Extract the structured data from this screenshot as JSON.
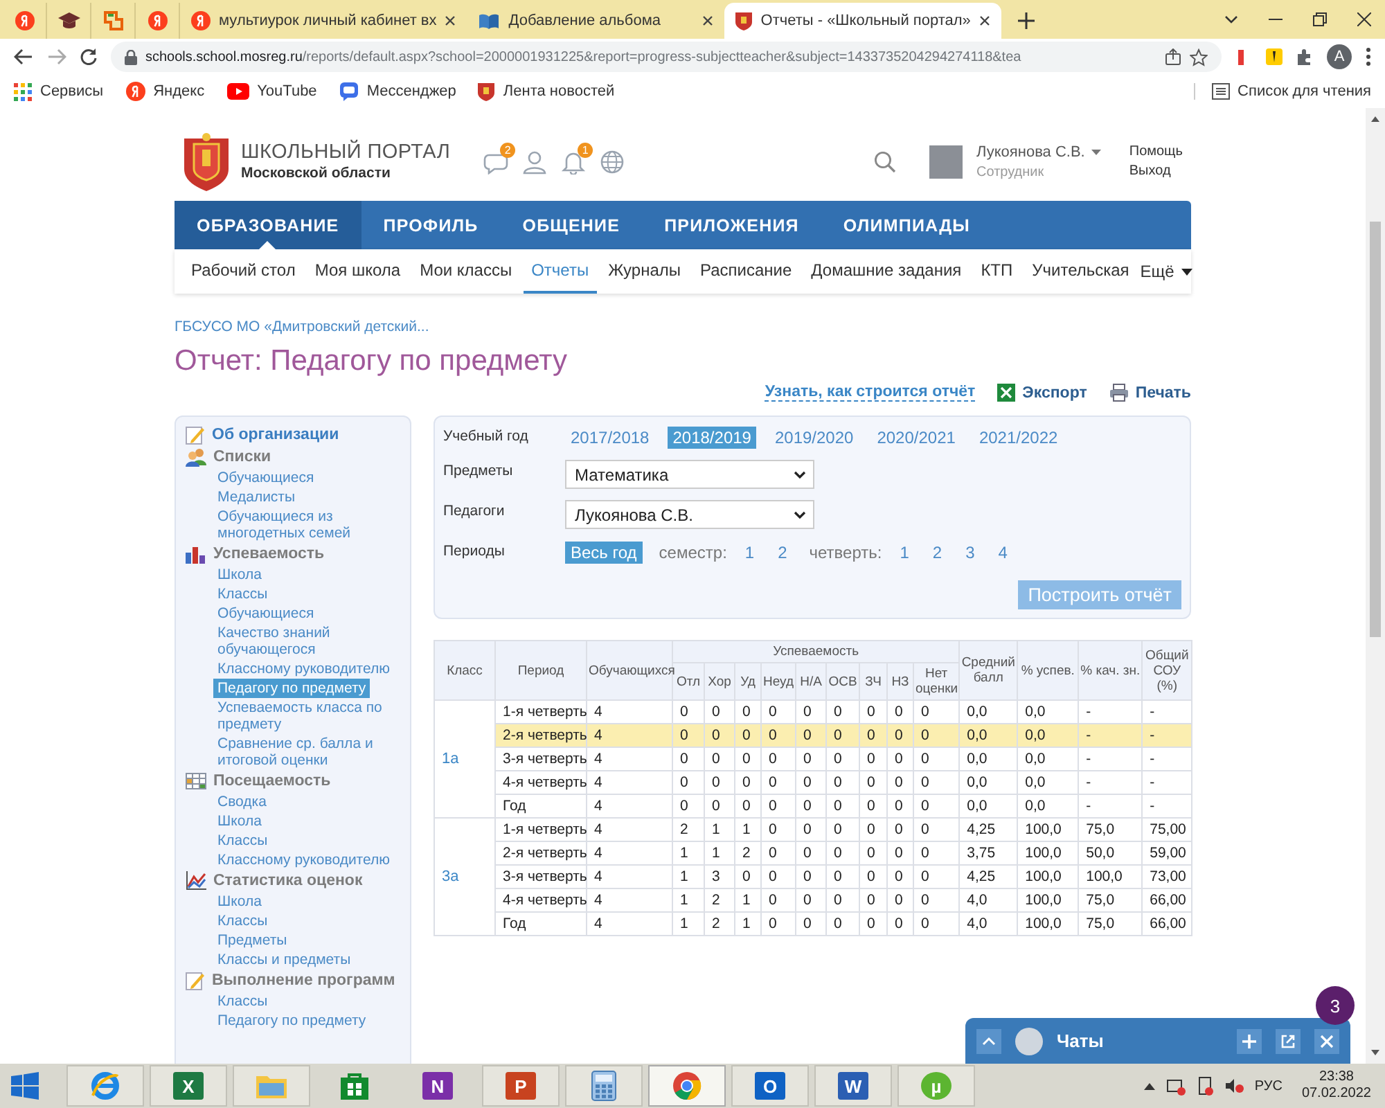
{
  "browser": {
    "tabs": [
      {
        "kind": "yandex",
        "selected": false
      },
      {
        "kind": "cap",
        "selected": false
      },
      {
        "kind": "bracket",
        "selected": false
      },
      {
        "kind": "yandex",
        "selected": false
      },
      {
        "kind": "yandex",
        "title": "мультиурок личный кабинет вх",
        "selected": false
      },
      {
        "kind": "book",
        "title": "Добавление альбома",
        "selected": false
      },
      {
        "kind": "emblem",
        "title": "Отчеты - «Школьный портал»",
        "selected": true
      }
    ],
    "url_host": "schools.school.mosreg.ru",
    "url_path": "/reports/default.aspx?school=2000001931225&report=progress-subjectteacher&subject=1433735204294274118&tea",
    "profile_initial": "A",
    "bookmarks": [
      {
        "kind": "apps",
        "label": "Сервисы"
      },
      {
        "kind": "yandex",
        "label": "Яндекс"
      },
      {
        "kind": "play",
        "label": "YouTube"
      },
      {
        "kind": "bubble",
        "label": "Мессенджер"
      },
      {
        "kind": "emblem",
        "label": "Лента новостей"
      }
    ],
    "reading_list": "Список для чтения"
  },
  "portal": {
    "logo_title": "ШКОЛЬНЫЙ ПОРТАЛ",
    "logo_subtitle": "Московской области",
    "message_count": "2",
    "notification_count": "1",
    "user": {
      "name": "Лукоянова С.В.",
      "role": "Сотрудник"
    },
    "links": [
      "Помощь",
      "Выход"
    ],
    "main_nav": [
      {
        "label": "ОБРАЗОВАНИЕ",
        "selected": true
      },
      {
        "label": "ПРОФИЛЬ",
        "selected": false
      },
      {
        "label": "ОБЩЕНИЕ",
        "selected": false
      },
      {
        "label": "ПРИЛОЖЕНИЯ",
        "selected": false
      },
      {
        "label": "ОЛИМПИАДЫ",
        "selected": false
      }
    ],
    "sub_nav": [
      {
        "label": "Рабочий стол",
        "selected": false
      },
      {
        "label": "Моя школа",
        "selected": false
      },
      {
        "label": "Мои классы",
        "selected": false
      },
      {
        "label": "Отчеты",
        "selected": true
      },
      {
        "label": "Журналы",
        "selected": false
      },
      {
        "label": "Расписание",
        "selected": false
      },
      {
        "label": "Домашние задания",
        "selected": false
      },
      {
        "label": "КТП",
        "selected": false
      },
      {
        "label": "Учительская",
        "selected": false
      }
    ],
    "more": "Ещё"
  },
  "report": {
    "breadcrumb": "ГБСУСО МО «Дмитровский детский...",
    "title": "Отчет: Педагогу по предмету",
    "help_link": "Узнать, как строится отчёт",
    "export": "Экспорт",
    "print": "Печать"
  },
  "sidebar": {
    "sections": [
      {
        "kind": "edit",
        "title": "Об организации"
      },
      {
        "kind": "people",
        "title": "Списки",
        "items": [
          {
            "label": "Обучающиеся",
            "selected": false
          },
          {
            "label": "Медалисты",
            "selected": false
          },
          {
            "label": "Обучающиеся из многодетных семей",
            "selected": false
          }
        ]
      },
      {
        "kind": "bars",
        "title": "Успеваемость",
        "items": [
          {
            "label": "Школа",
            "selected": false
          },
          {
            "label": "Классы",
            "selected": false
          },
          {
            "label": "Обучающиеся",
            "selected": false
          },
          {
            "label": "Качество знаний обучающегося",
            "selected": false
          },
          {
            "label": "Классному руководителю",
            "selected": false
          },
          {
            "label": "Педагогу по предмету",
            "selected": true
          },
          {
            "label": "Успеваемость класса по предмету",
            "selected": false
          },
          {
            "label": "Сравнение ср. балла и итоговой оценки",
            "selected": false
          }
        ]
      },
      {
        "kind": "grid",
        "title": "Посещаемость",
        "items": [
          {
            "label": "Сводка",
            "selected": false
          },
          {
            "label": "Школа",
            "selected": false
          },
          {
            "label": "Классы",
            "selected": false
          },
          {
            "label": "Классному руководителю",
            "selected": false
          }
        ]
      },
      {
        "kind": "chart",
        "title": "Статистика оценок",
        "items": [
          {
            "label": "Школа",
            "selected": false
          },
          {
            "label": "Классы",
            "selected": false
          },
          {
            "label": "Предметы",
            "selected": false
          },
          {
            "label": "Классы и предметы",
            "selected": false
          }
        ]
      },
      {
        "kind": "edit",
        "title": "Выполнение программ",
        "items": [
          {
            "label": "Классы",
            "selected": false
          },
          {
            "label": "Педагогу по предмету",
            "selected": false
          }
        ]
      }
    ]
  },
  "filters": {
    "year_label": "Учебный год",
    "years": [
      {
        "label": "2017/2018",
        "selected": false
      },
      {
        "label": "2018/2019",
        "selected": true
      },
      {
        "label": "2019/2020",
        "selected": false
      },
      {
        "label": "2020/2021",
        "selected": false
      },
      {
        "label": "2021/2022",
        "selected": false
      }
    ],
    "subject_label": "Предметы",
    "subject": "Математика",
    "teacher_label": "Педагоги",
    "teacher": "Лукоянова С.В.",
    "periods_label": "Периоды",
    "whole_year": {
      "label": "Весь год",
      "selected": true
    },
    "semester": {
      "label": "семестр:",
      "options": [
        {
          "label": "1",
          "selected": false
        },
        {
          "label": "2",
          "selected": false
        }
      ]
    },
    "quarter": {
      "label": "четверть:",
      "options": [
        {
          "label": "1",
          "selected": false
        },
        {
          "label": "2",
          "selected": false
        },
        {
          "label": "3",
          "selected": false
        },
        {
          "label": "4",
          "selected": false
        }
      ]
    },
    "build_button": "Построить отчёт"
  },
  "table": {
    "columns": [
      {
        "label": "Класс"
      },
      {
        "label": "Период"
      },
      {
        "label": "Обучающихся"
      },
      {
        "label": "Успеваемость",
        "subcolumns": [
          "Отл",
          "Хор",
          "Уд",
          "Неуд",
          "Н/А",
          "ОСВ",
          "ЗЧ",
          "НЗ",
          "Нет оценки"
        ]
      },
      {
        "label": "Средний балл"
      },
      {
        "label": "% успев."
      },
      {
        "label": "% кач. зн."
      },
      {
        "label": "Общий СОУ (%)"
      }
    ],
    "groups": [
      {
        "class": "1а",
        "rows": [
          {
            "cells": [
              "1-я четверть",
              "4",
              "0",
              "0",
              "0",
              "0",
              "0",
              "0",
              "0",
              "0",
              "0",
              "0,0",
              "0,0",
              "-",
              "-"
            ],
            "selected": false
          },
          {
            "cells": [
              "2-я четверть",
              "4",
              "0",
              "0",
              "0",
              "0",
              "0",
              "0",
              "0",
              "0",
              "0",
              "0,0",
              "0,0",
              "-",
              "-"
            ],
            "selected": true
          },
          {
            "cells": [
              "3-я четверть",
              "4",
              "0",
              "0",
              "0",
              "0",
              "0",
              "0",
              "0",
              "0",
              "0",
              "0,0",
              "0,0",
              "-",
              "-"
            ],
            "selected": false
          },
          {
            "cells": [
              "4-я четверть",
              "4",
              "0",
              "0",
              "0",
              "0",
              "0",
              "0",
              "0",
              "0",
              "0",
              "0,0",
              "0,0",
              "-",
              "-"
            ],
            "selected": false
          },
          {
            "cells": [
              "Год",
              "4",
              "0",
              "0",
              "0",
              "0",
              "0",
              "0",
              "0",
              "0",
              "0",
              "0,0",
              "0,0",
              "-",
              "-"
            ],
            "selected": false
          }
        ]
      },
      {
        "class": "3а",
        "rows": [
          {
            "cells": [
              "1-я четверть",
              "4",
              "2",
              "1",
              "1",
              "0",
              "0",
              "0",
              "0",
              "0",
              "0",
              "4,25",
              "100,0",
              "75,0",
              "75,00"
            ],
            "selected": false
          },
          {
            "cells": [
              "2-я четверть",
              "4",
              "1",
              "1",
              "2",
              "0",
              "0",
              "0",
              "0",
              "0",
              "0",
              "3,75",
              "100,0",
              "50,0",
              "59,00"
            ],
            "selected": false
          },
          {
            "cells": [
              "3-я четверть",
              "4",
              "1",
              "3",
              "0",
              "0",
              "0",
              "0",
              "0",
              "0",
              "0",
              "4,25",
              "100,0",
              "100,0",
              "73,00"
            ],
            "selected": false
          },
          {
            "cells": [
              "4-я четверть",
              "4",
              "1",
              "2",
              "1",
              "0",
              "0",
              "0",
              "0",
              "0",
              "0",
              "4,0",
              "100,0",
              "75,0",
              "66,00"
            ],
            "selected": false
          },
          {
            "cells": [
              "Год",
              "4",
              "1",
              "2",
              "1",
              "0",
              "0",
              "0",
              "0",
              "0",
              "0",
              "4,0",
              "100,0",
              "75,0",
              "66,00"
            ],
            "selected": false
          }
        ]
      }
    ]
  },
  "chat": {
    "title": "Чаты",
    "unread": "3"
  },
  "taskbar": {
    "apps": [
      {
        "kind": "ie",
        "running": true,
        "selected": false
      },
      {
        "kind": "excel",
        "glyph": "X",
        "running": true,
        "selected": false
      },
      {
        "kind": "folder",
        "running": true,
        "selected": false
      },
      {
        "kind": "store",
        "running": false,
        "selected": false
      },
      {
        "kind": "onenote",
        "glyph": "N",
        "running": false,
        "selected": false
      },
      {
        "kind": "powerpoint",
        "glyph": "P",
        "running": true,
        "selected": false
      },
      {
        "kind": "calc",
        "running": true,
        "selected": false
      },
      {
        "kind": "chrome",
        "running": true,
        "selected": true
      },
      {
        "kind": "outlook",
        "glyph": "O",
        "running": true,
        "selected": false
      },
      {
        "kind": "word",
        "glyph": "W",
        "running": true,
        "selected": false
      },
      {
        "kind": "torrent",
        "glyph": "µ",
        "running": true,
        "selected": false
      }
    ],
    "language": "РУС",
    "time": "23:38",
    "date": "07.02.2022"
  }
}
